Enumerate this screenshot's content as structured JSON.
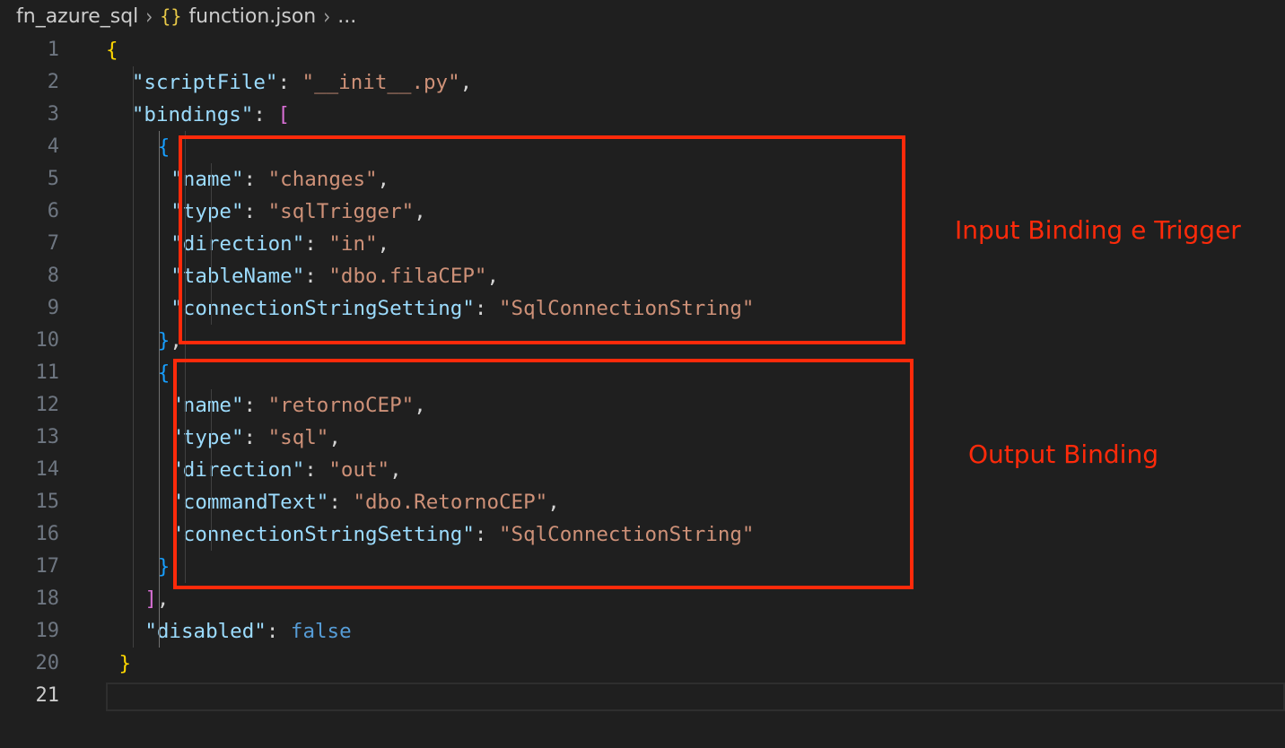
{
  "breadcrumb": {
    "folder": "fn_azure_sql",
    "icon": "{}",
    "file": "function.json",
    "more": "..."
  },
  "editor": {
    "active_line": "21",
    "lines": [
      {
        "n": "1",
        "tokens": [
          [
            "b1",
            "{"
          ]
        ]
      },
      {
        "n": "2",
        "tokens": [
          [
            "k",
            "\"scriptFile\""
          ],
          [
            "p",
            ": "
          ],
          [
            "s",
            "\"__init__.py\""
          ],
          [
            "p",
            ","
          ]
        ]
      },
      {
        "n": "3",
        "tokens": [
          [
            "k",
            "\"bindings\""
          ],
          [
            "p",
            ": "
          ],
          [
            "b2",
            "["
          ]
        ]
      },
      {
        "n": "4",
        "tokens": [
          [
            "b3",
            "{"
          ]
        ]
      },
      {
        "n": "5",
        "tokens": [
          [
            "k",
            "\"name\""
          ],
          [
            "p",
            ": "
          ],
          [
            "s",
            "\"changes\""
          ],
          [
            "p",
            ","
          ]
        ]
      },
      {
        "n": "6",
        "tokens": [
          [
            "k",
            "\"type\""
          ],
          [
            "p",
            ": "
          ],
          [
            "s",
            "\"sqlTrigger\""
          ],
          [
            "p",
            ","
          ]
        ]
      },
      {
        "n": "7",
        "tokens": [
          [
            "k",
            "\"direction\""
          ],
          [
            "p",
            ": "
          ],
          [
            "s",
            "\"in\""
          ],
          [
            "p",
            ","
          ]
        ]
      },
      {
        "n": "8",
        "tokens": [
          [
            "k",
            "\"tableName\""
          ],
          [
            "p",
            ": "
          ],
          [
            "s",
            "\"dbo.filaCEP\""
          ],
          [
            "p",
            ","
          ]
        ]
      },
      {
        "n": "9",
        "tokens": [
          [
            "k",
            "\"connectionStringSetting\""
          ],
          [
            "p",
            ": "
          ],
          [
            "s",
            "\"SqlConnectionString\""
          ]
        ]
      },
      {
        "n": "10",
        "tokens": [
          [
            "b3",
            "}"
          ],
          [
            "p",
            ","
          ]
        ]
      },
      {
        "n": "11",
        "tokens": [
          [
            "b3",
            "{"
          ]
        ]
      },
      {
        "n": "12",
        "tokens": [
          [
            "k",
            "\"name\""
          ],
          [
            "p",
            ": "
          ],
          [
            "s",
            "\"retornoCEP\""
          ],
          [
            "p",
            ","
          ]
        ]
      },
      {
        "n": "13",
        "tokens": [
          [
            "k",
            "\"type\""
          ],
          [
            "p",
            ": "
          ],
          [
            "s",
            "\"sql\""
          ],
          [
            "p",
            ","
          ]
        ]
      },
      {
        "n": "14",
        "tokens": [
          [
            "k",
            "\"direction\""
          ],
          [
            "p",
            ": "
          ],
          [
            "s",
            "\"out\""
          ],
          [
            "p",
            ","
          ]
        ]
      },
      {
        "n": "15",
        "tokens": [
          [
            "k",
            "\"commandText\""
          ],
          [
            "p",
            ": "
          ],
          [
            "s",
            "\"dbo.RetornoCEP\""
          ],
          [
            "p",
            ","
          ]
        ]
      },
      {
        "n": "16",
        "tokens": [
          [
            "k",
            "\"connectionStringSetting\""
          ],
          [
            "p",
            ": "
          ],
          [
            "s",
            "\"SqlConnectionString\""
          ]
        ]
      },
      {
        "n": "17",
        "tokens": [
          [
            "b3",
            "}"
          ]
        ]
      },
      {
        "n": "18",
        "tokens": [
          [
            "b2",
            "]"
          ],
          [
            "p",
            ","
          ]
        ]
      },
      {
        "n": "19",
        "tokens": [
          [
            "k",
            "\"disabled\""
          ],
          [
            "p",
            ": "
          ],
          [
            "kw",
            "false"
          ]
        ]
      },
      {
        "n": "20",
        "tokens": [
          [
            "b1",
            "}"
          ]
        ]
      },
      {
        "n": "21",
        "tokens": []
      }
    ]
  },
  "annotations": {
    "input_label": "Input Binding e Trigger",
    "output_label": "Output Binding",
    "highlight_color": "#ff2a0a"
  },
  "theme": {
    "background": "#1f1f1f",
    "key_color": "#9cdcfe",
    "string_color": "#ce9178",
    "keyword_color": "#569cd6"
  }
}
